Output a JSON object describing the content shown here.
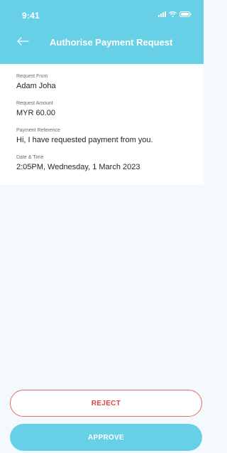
{
  "status_bar": {
    "time": "9:41",
    "icons": [
      "signal-icon",
      "wifi-icon",
      "battery-icon"
    ]
  },
  "header": {
    "title": "Authorise Payment Request",
    "back_icon": "back-arrow-icon"
  },
  "request": {
    "from_label": "Request From",
    "from_value": "Adam Joha",
    "amount_label": "Request Amount",
    "amount_value": "MYR 60.00",
    "reference_label": "Payment Reference",
    "reference_value": "Hi, I have requested payment from you.",
    "datetime_label": "Date & Time",
    "datetime_value": "2:05PM, Wednesday, 1 March  2023"
  },
  "actions": {
    "reject_label": "REJECT",
    "approve_label": "APPROVE"
  },
  "colors": {
    "accent": "#67cfe6",
    "reject": "#d84a4a",
    "background": "#f3f9fd"
  }
}
